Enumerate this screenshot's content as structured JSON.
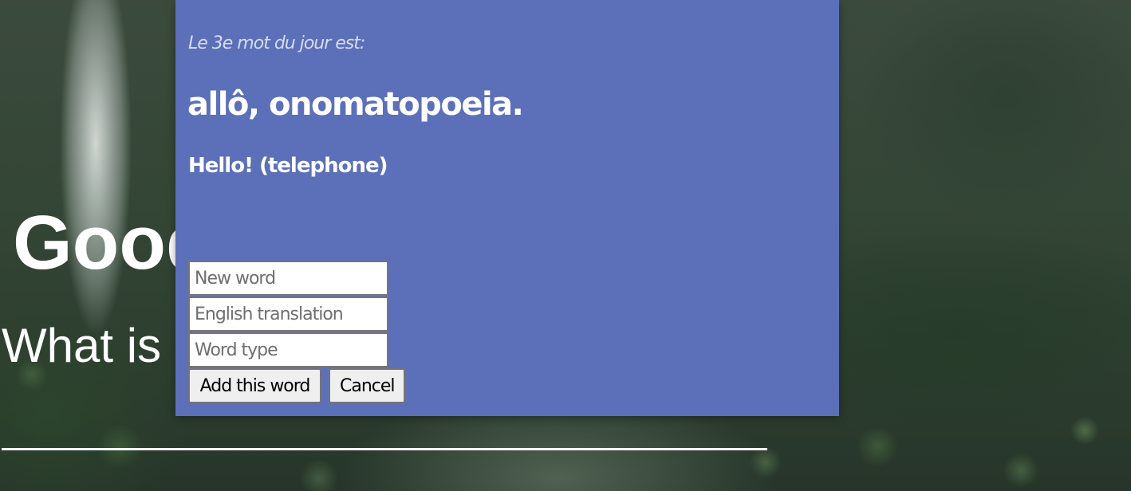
{
  "background": {
    "greeting_text": "Good",
    "question_text": "What is",
    "colors": {
      "forest_dark": "#2e3f30",
      "text": "#ffffff"
    }
  },
  "word_card": {
    "intro": "Le 3e mot du jour est:",
    "word": "allô, onomatopoeia.",
    "translation": "Hello! (telephone)",
    "background_color": "#5c70b9"
  },
  "add_word_form": {
    "new_word": {
      "value": "",
      "placeholder": "New word"
    },
    "english_translation": {
      "value": "",
      "placeholder": "English translation"
    },
    "word_type": {
      "value": "",
      "placeholder": "Word type"
    },
    "add_button_label": "Add this word",
    "cancel_button_label": "Cancel"
  }
}
